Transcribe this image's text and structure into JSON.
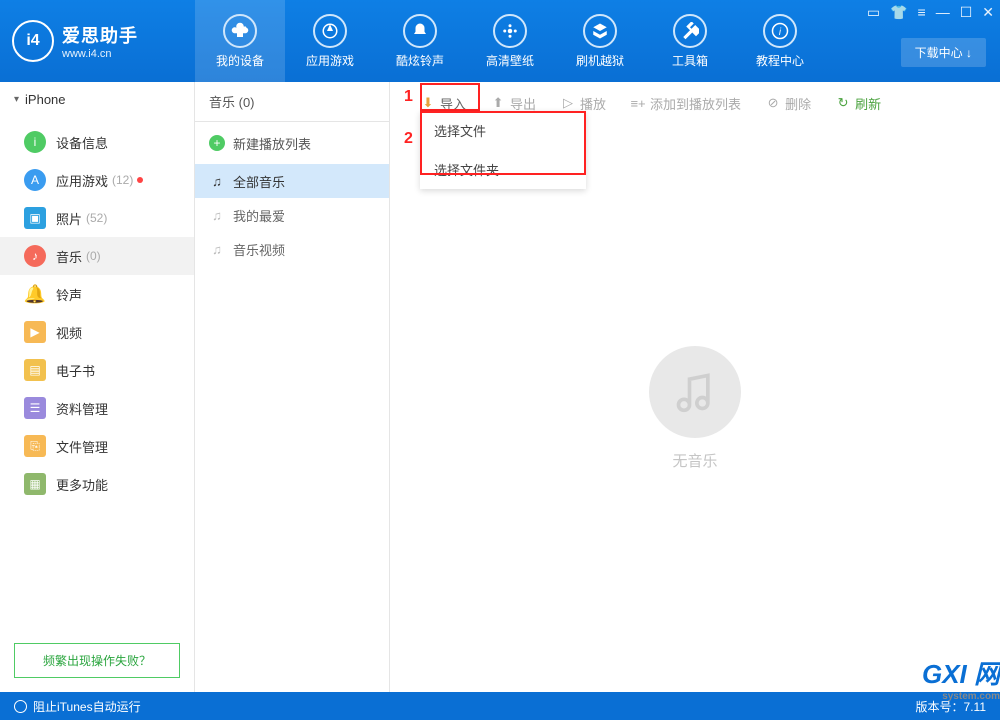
{
  "brand": {
    "name": "爱思助手",
    "url": "www.i4.cn",
    "logo_text": "i4"
  },
  "nav": [
    {
      "label": "我的设备"
    },
    {
      "label": "应用游戏"
    },
    {
      "label": "酷炫铃声"
    },
    {
      "label": "高清壁纸"
    },
    {
      "label": "刷机越狱"
    },
    {
      "label": "工具箱"
    },
    {
      "label": "教程中心"
    }
  ],
  "download_center": "下载中心 ↓",
  "device_name": "iPhone",
  "sidebar": [
    {
      "label": "设备信息",
      "icon": "i",
      "count": "",
      "color": "#4fcb64"
    },
    {
      "label": "应用游戏",
      "icon": "A",
      "count": "(12)",
      "color": "#3a9cf0",
      "dot": true
    },
    {
      "label": "照片",
      "icon": "▣",
      "count": "(52)",
      "color": "#2ca0e0",
      "square": true
    },
    {
      "label": "音乐",
      "icon": "♪",
      "count": "(0)",
      "color": "#f56a5b",
      "active": true
    },
    {
      "label": "铃声",
      "icon": "🔔",
      "count": "",
      "color": "#2ca0e0",
      "plain": true
    },
    {
      "label": "视频",
      "icon": "▶",
      "count": "",
      "color": "#f7b955",
      "square": true
    },
    {
      "label": "电子书",
      "icon": "📕",
      "count": "",
      "color": "#f2c14e",
      "square": true
    },
    {
      "label": "资料管理",
      "icon": "☰",
      "count": "",
      "color": "#9a8add",
      "square": true
    },
    {
      "label": "文件管理",
      "icon": "⎘",
      "count": "",
      "color": "#f7b955",
      "square": true
    },
    {
      "label": "更多功能",
      "icon": "▦",
      "count": "",
      "color": "#8fb86c",
      "square": true
    }
  ],
  "faq": "频繁出现操作失败？",
  "tab_header": "音乐 (0)",
  "new_playlist": "新建播放列表",
  "sublist": [
    {
      "label": "全部音乐",
      "active": true
    },
    {
      "label": "我的最爱"
    },
    {
      "label": "音乐视频"
    }
  ],
  "toolbar": {
    "import": "导入",
    "export": "导出",
    "play": "播放",
    "add_to_playlist": "添加到播放列表",
    "delete": "删除",
    "refresh": "刷新"
  },
  "annotations": {
    "one": "1",
    "two": "2"
  },
  "dropdown": {
    "select_file": "选择文件",
    "select_folder": "选择文件夹"
  },
  "empty_text": "无音乐",
  "footer": {
    "itunes": "阻止iTunes自动运行",
    "version_label": "版本号：",
    "version": "7.11"
  },
  "watermark": {
    "main": "GXI 网",
    "sub": "system.com"
  }
}
